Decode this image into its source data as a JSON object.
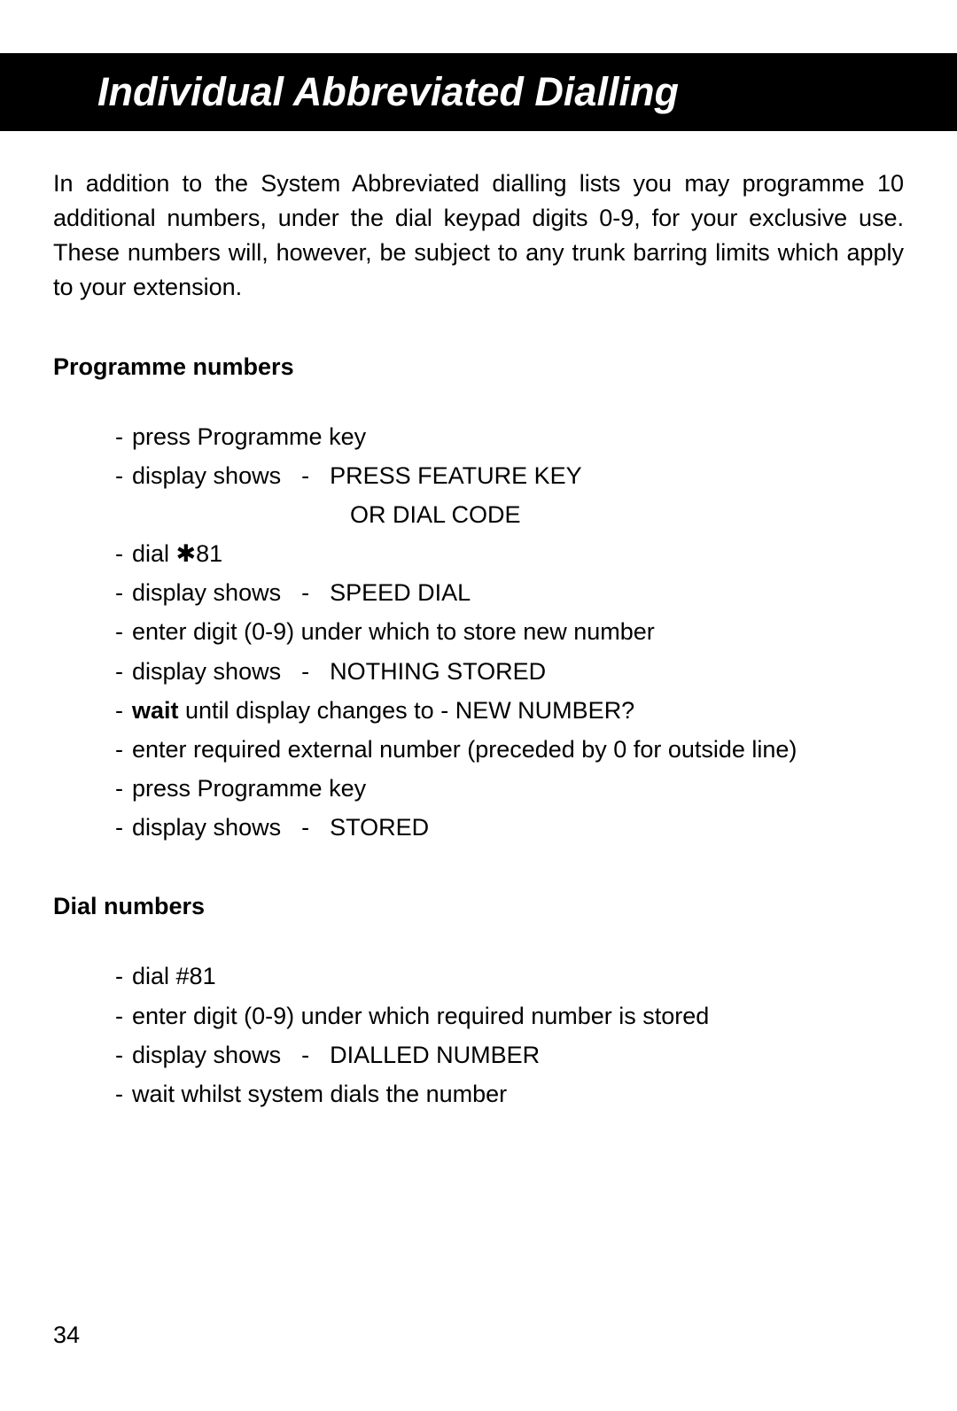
{
  "header": {
    "title": "Individual Abbreviated Dialling"
  },
  "intro": "In addition to the System Abbreviated dialling lists you may programme 10 additional numbers, under the dial keypad digits 0-9, for your exclusive use. These numbers will, however, be subject to any trunk barring limits which apply to your extension.",
  "section1": {
    "heading": "Programme numbers",
    "steps": {
      "s1": "press Programme key",
      "s2_label": "display shows",
      "s2_sep": "-",
      "s2_val1": "PRESS FEATURE KEY",
      "s2_val2": "OR DIAL CODE",
      "s3_pre": "dial ",
      "s3_star": "✱",
      "s3_post": "81",
      "s4_label": "display shows",
      "s4_sep": "-",
      "s4_val": "SPEED DIAL",
      "s5": "enter digit (0-9) under which to store new number",
      "s6_label": "display shows",
      "s6_sep": "-",
      "s6_val": "NOTHING STORED",
      "s7_bold": "wait",
      "s7_rest": " until display changes to  -  NEW NUMBER?",
      "s8": "enter required external number (preceded by 0 for outside line)",
      "s9": "press Programme key",
      "s10_label": "display shows",
      "s10_sep": "-",
      "s10_val": "STORED"
    }
  },
  "section2": {
    "heading": "Dial numbers",
    "steps": {
      "s1": "dial #81",
      "s2": "enter digit (0-9) under which required number is stored",
      "s3_label": "display shows",
      "s3_sep": "-",
      "s3_val": "DIALLED NUMBER",
      "s4": "wait whilst system dials the number"
    }
  },
  "page_number": "34"
}
